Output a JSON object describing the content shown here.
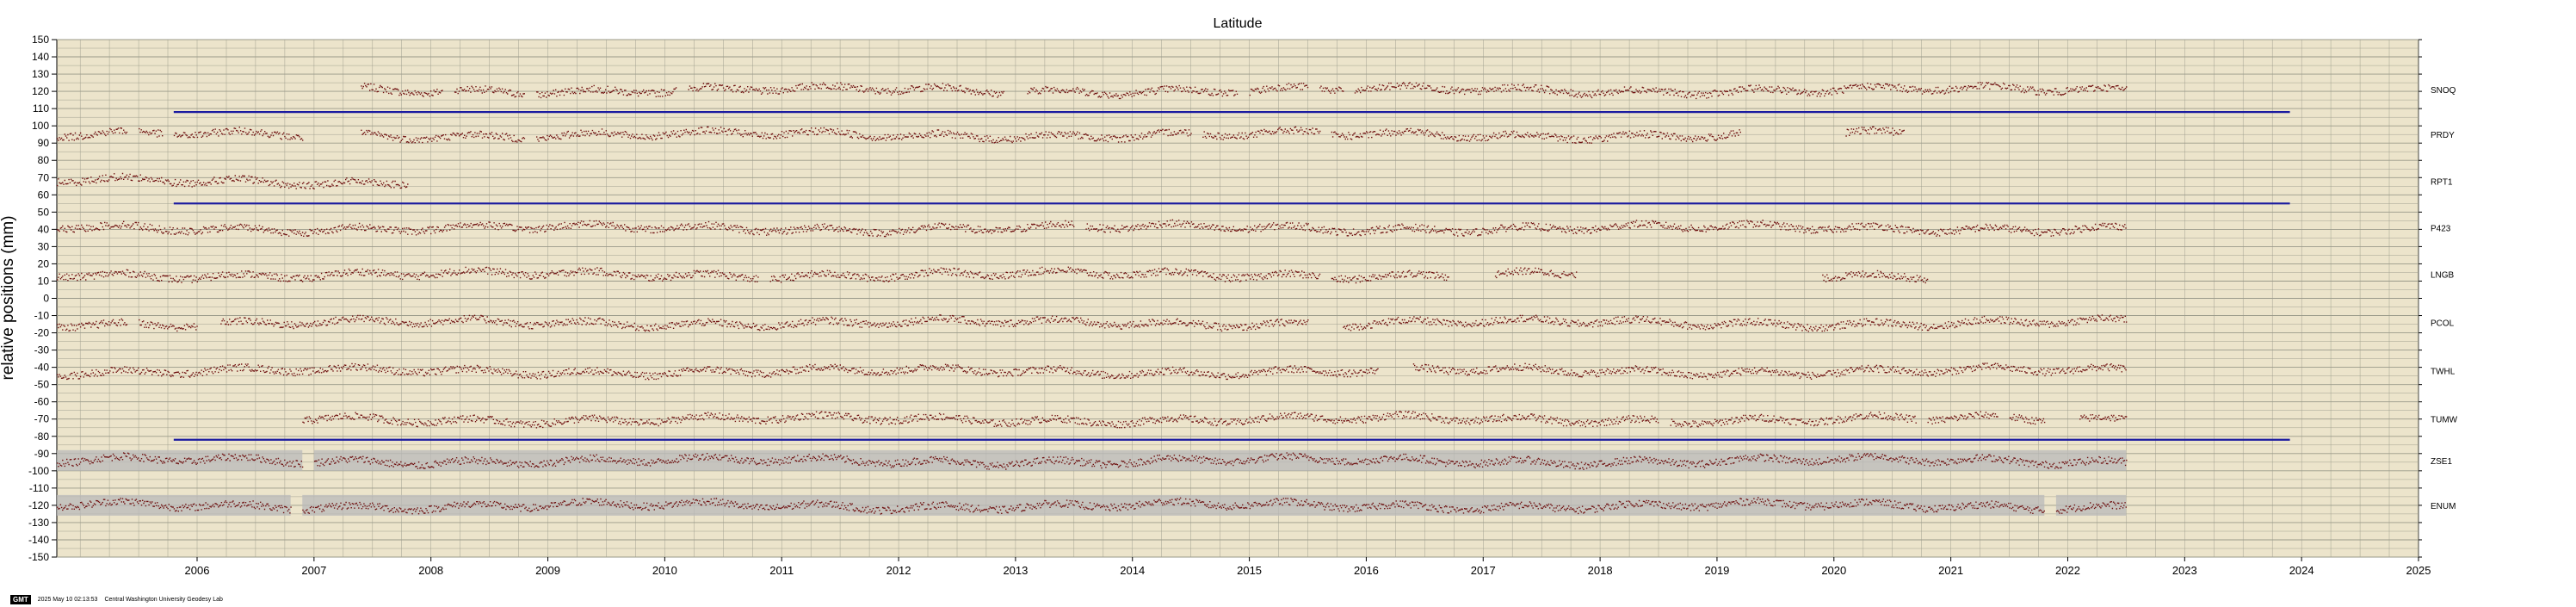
{
  "chart_data": {
    "type": "scatter",
    "title": "Latitude",
    "ylabel": "relative positions (mm)",
    "xlabel": "",
    "xlim": [
      2005.3,
      2025.5
    ],
    "ylim": [
      -150,
      150
    ],
    "yticks": [
      150,
      140,
      130,
      120,
      110,
      100,
      90,
      80,
      70,
      60,
      50,
      40,
      30,
      20,
      10,
      0,
      -10,
      -20,
      -30,
      -40,
      -50,
      -60,
      -70,
      -80,
      -90,
      -100,
      -110,
      -120,
      -130,
      -140,
      -150
    ],
    "xtick_labels": [
      "2006",
      "2007",
      "2008",
      "2009",
      "2010",
      "2011",
      "2012",
      "2013",
      "2014",
      "2015",
      "2016",
      "2017",
      "2018",
      "2019",
      "2020",
      "2021",
      "2022",
      "2023",
      "2024",
      "2025"
    ],
    "xtick_values": [
      2006.5,
      2007.5,
      2008.5,
      2009.5,
      2010.5,
      2011.5,
      2012.5,
      2013.5,
      2014.5,
      2015.5,
      2016.5,
      2017.5,
      2018.5,
      2019.5,
      2020.5,
      2021.5,
      2022.5,
      2023.5,
      2024.5,
      2025.5
    ],
    "grid": true,
    "stations": [
      {
        "name": "SNOQ",
        "offset": 121,
        "segments": [
          [
            2007.9,
            2008.6
          ],
          [
            2008.7,
            2009.3
          ],
          [
            2009.4,
            2009.8
          ],
          [
            2009.8,
            2010.6
          ],
          [
            2010.7,
            2012.0
          ],
          [
            2012.0,
            2013.4
          ],
          [
            2013.6,
            2015.4
          ],
          [
            2015.5,
            2016.0
          ],
          [
            2016.1,
            2016.3
          ],
          [
            2016.4,
            2023.0
          ]
        ],
        "mark_color": "#6e0f0f",
        "band": false
      },
      {
        "name": "PRDY",
        "offset": 95,
        "segments": [
          [
            2005.3,
            2005.9
          ],
          [
            2006.0,
            2006.2
          ],
          [
            2006.3,
            2007.4
          ],
          [
            2007.9,
            2009.3
          ],
          [
            2009.4,
            2012.0
          ],
          [
            2012.0,
            2015.0
          ],
          [
            2015.1,
            2016.1
          ],
          [
            2016.2,
            2019.3
          ],
          [
            2019.3,
            2019.7
          ],
          [
            2020.6,
            2021.1
          ]
        ],
        "mark_color": "#6e0f0f",
        "band": false
      },
      {
        "name": "RPT1",
        "offset": 68,
        "segments": [
          [
            2005.3,
            2008.3
          ]
        ],
        "mark_color": "#6e0f0f",
        "band": false
      },
      {
        "name": "P423",
        "offset": 41,
        "segments": [
          [
            2005.3,
            2014.0
          ],
          [
            2014.1,
            2023.0
          ]
        ],
        "mark_color": "#6e0f0f",
        "band": false
      },
      {
        "name": "LNGB",
        "offset": 14,
        "segments": [
          [
            2005.3,
            2011.3
          ],
          [
            2011.4,
            2016.1
          ],
          [
            2016.2,
            2017.2
          ],
          [
            2017.6,
            2018.3
          ],
          [
            2020.4,
            2020.9
          ],
          [
            2020.9,
            2021.3
          ]
        ],
        "mark_color": "#6e0f0f",
        "band": false
      },
      {
        "name": "PCOL",
        "offset": -14,
        "segments": [
          [
            2005.3,
            2005.9
          ],
          [
            2006.0,
            2006.5
          ],
          [
            2006.7,
            2016.0
          ],
          [
            2016.3,
            2023.0
          ]
        ],
        "mark_color": "#6e0f0f",
        "band": false
      },
      {
        "name": "TWHL",
        "offset": -42,
        "segments": [
          [
            2005.3,
            2016.6
          ],
          [
            2016.9,
            2023.0
          ]
        ],
        "mark_color": "#6e0f0f",
        "band": false
      },
      {
        "name": "TUMW",
        "offset": -70,
        "segments": [
          [
            2007.4,
            2019.0
          ],
          [
            2019.1,
            2021.2
          ],
          [
            2021.3,
            2021.9
          ],
          [
            2022.0,
            2022.3
          ],
          [
            2022.6,
            2023.0
          ]
        ],
        "mark_color": "#6e0f0f",
        "band": false
      },
      {
        "name": "ZSE1",
        "offset": -94,
        "segments": [
          [
            2005.3,
            2007.4
          ],
          [
            2007.5,
            2023.0
          ]
        ],
        "mark_color": "#6e0f0f",
        "band": true
      },
      {
        "name": "ENUM",
        "offset": -120,
        "segments": [
          [
            2005.3,
            2007.3
          ],
          [
            2007.4,
            2022.3
          ],
          [
            2022.4,
            2023.0
          ]
        ],
        "mark_color": "#6e0f0f",
        "band": true
      }
    ],
    "separator_lines": [
      {
        "y": 108,
        "x": [
          2006.3,
          2024.4
        ]
      },
      {
        "y": 55,
        "x": [
          2006.3,
          2024.4
        ]
      },
      {
        "y": -82,
        "x": [
          2006.3,
          2024.4
        ]
      }
    ],
    "colors": {
      "plot_background": "#ece4cb",
      "grid": "#9a9a8a",
      "data_points": "#6e0f0f",
      "error_band": "#b9b9b9",
      "separator": "#1a1aa0"
    }
  },
  "footer": {
    "badge": "GMT",
    "timestamp": "2025 May 10 02:13:53",
    "credit": "Central Washington University Geodesy Lab"
  }
}
